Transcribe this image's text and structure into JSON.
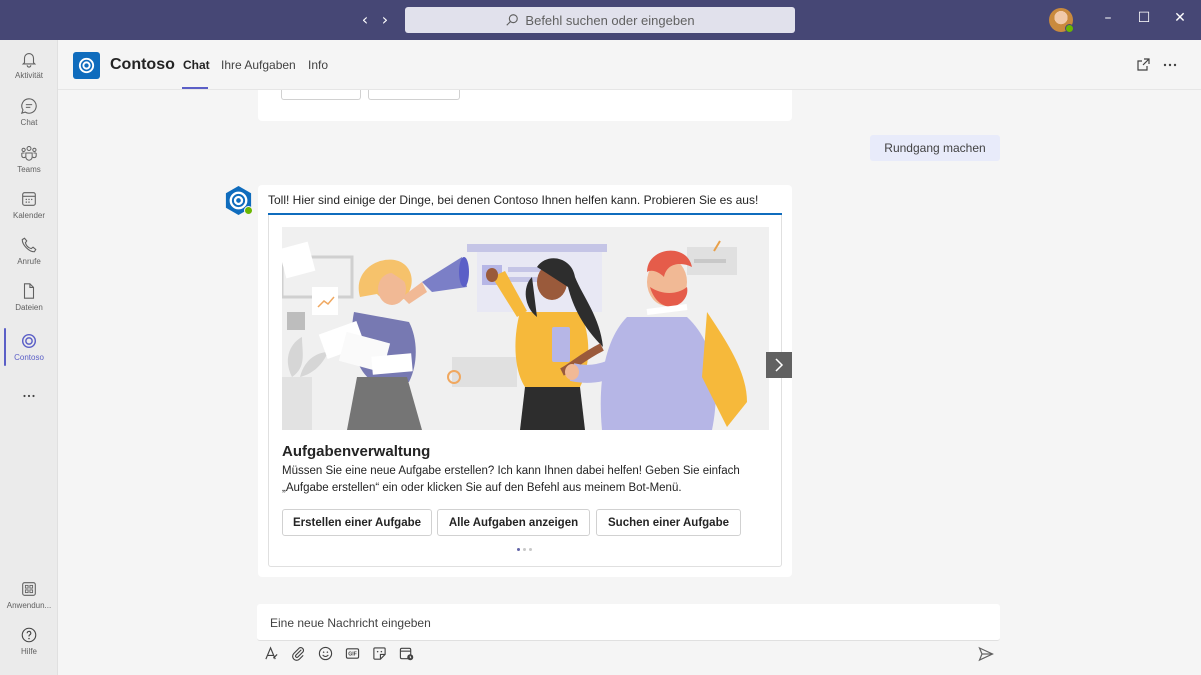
{
  "titlebar": {
    "back_icon": "chevron-left-icon",
    "forward_icon": "chevron-right-icon",
    "search_placeholder": "Befehl suchen oder eingeben",
    "window_controls": [
      "minimize-icon",
      "maximize-icon",
      "close-icon"
    ]
  },
  "rail": {
    "items": [
      {
        "label": "Aktivität",
        "icon": "bell-icon"
      },
      {
        "label": "Chat",
        "icon": "chat-icon"
      },
      {
        "label": "Teams",
        "icon": "teams-icon"
      },
      {
        "label": "Kalender",
        "icon": "calendar-icon"
      },
      {
        "label": "Anrufe",
        "icon": "phone-icon"
      },
      {
        "label": "Dateien",
        "icon": "file-icon"
      },
      {
        "label": "Contoso",
        "icon": "contoso-icon",
        "active": true
      },
      {
        "label": "",
        "icon": "more-icon"
      }
    ],
    "bottom": [
      {
        "label": "Anwendun...",
        "icon": "apps-icon"
      },
      {
        "label": "Hilfe",
        "icon": "help-icon"
      }
    ]
  },
  "app_header": {
    "name": "Contoso",
    "tabs": [
      {
        "label": "Chat",
        "active": true
      },
      {
        "label": "Ihre Aufgaben"
      },
      {
        "label": "Info"
      }
    ]
  },
  "chat": {
    "tour_button": "Rundgang machen",
    "bot_message": "Toll! Hier sind einige der Dinge, bei denen Contoso Ihnen helfen kann. Probieren Sie es aus!",
    "card": {
      "title": "Aufgabenverwaltung",
      "body": "Müssen Sie eine neue Aufgabe erstellen? Ich kann Ihnen dabei helfen! Geben Sie einfach „Aufgabe erstellen“ ein oder klicken Sie auf den Befehl aus meinem Bot-Menü.",
      "buttons": [
        "Erstellen einer Aufgabe",
        "Alle Aufgaben anzeigen",
        "Suchen einer Aufgabe"
      ],
      "carousel_page": 1,
      "carousel_total": 3
    }
  },
  "compose": {
    "placeholder": "Eine neue Nachricht eingeben",
    "tools": [
      "format-icon",
      "attach-icon",
      "emoji-icon",
      "gif-icon",
      "sticker-icon",
      "schedule-meeting-icon"
    ],
    "send_icon": "send-icon"
  },
  "colors": {
    "titlebar": "#464775",
    "accent": "#5b5fc7",
    "brand": "#0f6cbd",
    "presence": "#6bb700"
  }
}
